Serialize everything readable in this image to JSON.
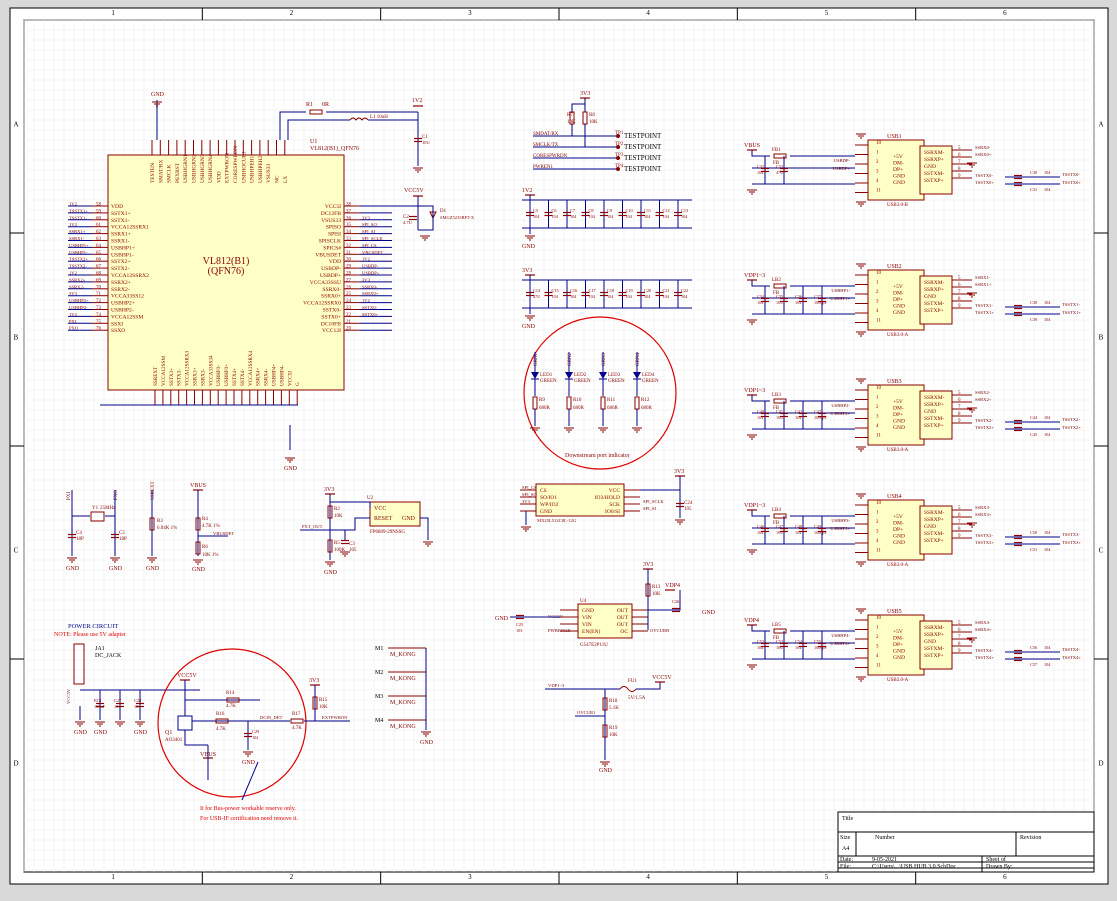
{
  "frame": {
    "col_labels": [
      "1",
      "2",
      "3",
      "4",
      "5",
      "6"
    ],
    "row_labels": [
      "A",
      "B",
      "C",
      "D"
    ]
  },
  "chip": {
    "label": "VL812(B1)",
    "sublabel": "(QFN76)",
    "designator": "U1",
    "comment": "VL812(B1)_QFN76",
    "left_pins": [
      "VDD",
      "SSTX1+",
      "SSTX1-",
      "VCCA12SSRX1",
      "SSRX1+",
      "SSRX1-",
      "USBHP1+",
      "USBHP1-",
      "SSTX2+",
      "SSTX2-",
      "VCCA12SSRX2",
      "SSRX2+",
      "SSRX2-",
      "VCCA33SS12",
      "USBHP2+",
      "USBHP2-",
      "VCCA12SSM",
      "SSXI",
      "SSXO"
    ],
    "left_nums": [
      "58",
      "59",
      "60",
      "61",
      "62",
      "63",
      "64",
      "65",
      "66",
      "67",
      "68",
      "69",
      "70",
      "71",
      "72",
      "73",
      "74",
      "75",
      "76"
    ],
    "right_pins": [
      "VCC5I",
      "DC12FB",
      "VSUS33",
      "SPISO",
      "SPISI",
      "SPISCLK",
      "SPICS#",
      "VBUSDET",
      "VDD",
      "USBDP-",
      "USBDP+",
      "VCCA33SSU",
      "SSRX0-",
      "SSRX0+",
      "VCCA12SSRX0",
      "SSTX0-",
      "SSTX0+",
      "DC10FB",
      "VCC12I"
    ],
    "right_nums": [
      "38",
      "37",
      "36",
      "35",
      "34",
      "33",
      "32",
      "31",
      "30",
      "29",
      "28",
      "27",
      "26",
      "25",
      "24",
      "23",
      "22",
      "21",
      "20"
    ],
    "top_pins": [
      "TESTEN",
      "SMAT/RX",
      "SMCLK",
      "PEXRST",
      "USBHGRN1",
      "USBHGRN2",
      "USBHGRN3",
      "USBHGRN4",
      "VDD",
      "EXTPWRON",
      "CORESPWRDN",
      "USBHOCUR1",
      "USBHPEH1",
      "USBHPEH2",
      "VSUS33",
      "NC",
      "LX"
    ],
    "bottom_pins": [
      "SSREXT",
      "VCCA12SSM",
      "SSTX3+",
      "SSTX3-",
      "VCCA12SSRX3",
      "SSRX3+",
      "SSRX3-",
      "VCCA33SS34",
      "USBHP3-",
      "USBHP3+",
      "SSTX4+",
      "SSTX4-",
      "VCCA12SSRX4",
      "SSRX4+",
      "SSRX4-",
      "USBHP4+",
      "USBHP4-",
      "VCC5I",
      "G"
    ],
    "left_nets": [
      "1V2",
      "TSSTX1+",
      "TSSTX1-",
      "1V2",
      "SSRX1+",
      "SSRX1-",
      "USBHP1+",
      "USBHP1-",
      "TSSTX2+",
      "TSSTX2-",
      "1V2",
      "SSRX2+",
      "SSRX2-",
      "3V3",
      "USBHP2+",
      "USBHP2-",
      "1V2",
      "PXI",
      "PXO"
    ],
    "right_nets": [
      "",
      "",
      "3V3",
      "SPI_SO",
      "SPI_SI",
      "SPI_SCLK",
      "SPI_CS",
      "VBUSDET",
      "1V2",
      "USBDP-",
      "USBDP+",
      "3V3",
      "SSRX0-",
      "SSRX0+",
      "1V2",
      "SSTX0-",
      "SSTX0+",
      "",
      ""
    ]
  },
  "power_top": {
    "gnd": "GND",
    "r1": "R1",
    "r1_val": "0R",
    "l1": "L1 10uH",
    "net_1v2": "1V2",
    "c1": "C1",
    "c1_val": "10U",
    "vcc5v": "VCC5V",
    "c2": "C2",
    "c2_val": "4.7U",
    "d1": "D1",
    "d1_val": "SMGZ5235BPT-X",
    "gnd_label": "GND"
  },
  "testpoints": {
    "net_3v3": "3V3",
    "r7": "R7",
    "r7_val": "10K",
    "r8": "R8",
    "r8_val": "10K",
    "nets": [
      "SMDAT/RX",
      "SMCLK/TX",
      "CORESPWRDN",
      "PWREN1"
    ],
    "tps": [
      "TP1",
      "TP2",
      "TP3",
      "TP4"
    ],
    "tp_label": "TESTPOINT"
  },
  "decoupling": {
    "net_1v2": "1V2",
    "net_3v3": "3V3",
    "gnd": "GND",
    "row1_caps": [
      "C5",
      "C6",
      "C7",
      "C8",
      "C9",
      "C10",
      "C11",
      "C12",
      "C13"
    ],
    "row1_val": "104",
    "row2_caps": [
      "C14",
      "C15",
      "C16",
      "C17",
      "C18",
      "C19",
      "C20",
      "C21",
      "C22"
    ],
    "row2_first_val": "47U",
    "row2_val": "104"
  },
  "leds": {
    "nets": [
      "GRN1",
      "GRN2",
      "GRN3",
      "GRN4"
    ],
    "leds": [
      "LED1",
      "LED2",
      "LED3",
      "LED4"
    ],
    "color": "GREEN",
    "resistors": [
      "R9",
      "R10",
      "R11",
      "R12"
    ],
    "res_val": "680R",
    "annotation": "Downstream port indicator"
  },
  "usb_ports": [
    {
      "designator": "USB1",
      "type": "USB3.0-B",
      "power": "VBUS",
      "fb": "FB1",
      "fb_val": "FB",
      "caps": [
        "C32",
        "C33"
      ],
      "cap_vals": [
        "104",
        "47U"
      ],
      "dm": "USBDP-",
      "dp": "USBDP+",
      "rx_minus": "SSRX0-",
      "rx_plus": "SSRX0+",
      "tx_minus": "TSSTX0-",
      "tx_plus": "TSSTX0+",
      "out_caps": [
        "C30",
        "C31"
      ]
    },
    {
      "designator": "USB2",
      "type": "USB3.0-A",
      "power": "VDP1~3",
      "fb": "LB2",
      "fb_val": "FB",
      "caps": [
        "C34",
        "C35",
        "C36",
        "C37"
      ],
      "cap_vals": [
        "104",
        "10U",
        "104",
        "1000pF"
      ],
      "dm": "USBHP1-",
      "dp": "USBHP1+",
      "rx_minus": "SSRX1-",
      "rx_plus": "SSRX1+",
      "tx_minus": "TSSTX1-",
      "tx_plus": "TSSTX1+",
      "out_caps": [
        "C38",
        "C39"
      ]
    },
    {
      "designator": "USB3",
      "type": "USB3.0-A",
      "power": "VDP1~3",
      "fb": "LB3",
      "fb_val": "FB",
      "caps": [
        "C40",
        "C41",
        "C42",
        "C43"
      ],
      "cap_vals": [
        "104",
        "10U",
        "104",
        "1000pF"
      ],
      "dm": "USBHP2-",
      "dp": "USBHP2+",
      "rx_minus": "SSRX2-",
      "rx_plus": "SSRX2+",
      "tx_minus": "TSSTX2-",
      "tx_plus": "TSSTX2+",
      "out_caps": [
        "C44",
        "C45"
      ]
    },
    {
      "designator": "USB4",
      "type": "USB3.0-A",
      "power": "VDP1~3",
      "fb": "LB4",
      "fb_val": "FB",
      "caps": [
        "C46",
        "C47",
        "C48",
        "C49"
      ],
      "cap_vals": [
        "104",
        "10U",
        "104",
        "1000pF"
      ],
      "dm": "USBHP3-",
      "dp": "USBHP3+",
      "rx_minus": "SSRX3-",
      "rx_plus": "SSRX3+",
      "tx_minus": "TSSTX3-",
      "tx_plus": "TSSTX3+",
      "out_caps": [
        "C50",
        "C51"
      ]
    },
    {
      "designator": "USB5",
      "type": "USB3.0-A",
      "power": "VDP4",
      "fb": "LB5",
      "fb_val": "FB",
      "caps": [
        "C52",
        "C53",
        "C54",
        "C55"
      ],
      "cap_vals": [
        "104",
        "10U",
        "104",
        "1000pF"
      ],
      "dm": "USBHP4-",
      "dp": "USBHP4+",
      "rx_minus": "SSRX4-",
      "rx_plus": "SSRX4+",
      "tx_minus": "TSSTX4-",
      "tx_plus": "TSSTX4+",
      "out_caps": [
        "C56",
        "C57"
      ]
    }
  ],
  "usb_pins": {
    "n10": "10",
    "n5": "5",
    "n6": "6",
    "n7": "7",
    "n8": "8",
    "n9": "9",
    "n11": "11",
    "n1": "1",
    "n2": "2",
    "n3": "3",
    "n4": "4",
    "left": [
      "+5V",
      "DM-",
      "DP+",
      "GND",
      "GND"
    ],
    "right": [
      "SSRXM-",
      "SSRXP+",
      "GND",
      "SSTXM-",
      "SSTXP+"
    ],
    "cap_val": "104"
  },
  "crystal": {
    "y1": "Y1",
    "y1_val": "25MHz",
    "c4": "C4",
    "c4_val": "18P",
    "c5": "C5",
    "c5_val": "18P",
    "net_xi": "PXI",
    "net_xo": "PXO",
    "gnd": "GND"
  },
  "ssrext": {
    "r3": "R3",
    "r3_val": "6.04K 1%",
    "net": "SSREXT",
    "gnd": "GND"
  },
  "vbusdet": {
    "vbus": "VBUS",
    "r4": "R4",
    "r4_val": "4.7K 1%",
    "net": "VBUSDET",
    "r6": "R6",
    "r6_val": "10K 1%",
    "gnd": "GND"
  },
  "reset": {
    "net_3v3": "3V3",
    "r2": "R2",
    "r2_val": "10K",
    "r5": "R5",
    "r5_val": "100K",
    "c3": "C3",
    "c3_val": "105",
    "u2": "U2",
    "u2_val": "FP6809-29NSSG",
    "pin_vcc": "VCC",
    "pin_reset": "RESET",
    "pin_gnd": "GND",
    "net": "PXT_OUT",
    "gnd": "GND"
  },
  "flash": {
    "u3_val": "MX25L512C0L-12G",
    "pins_left": [
      "CS",
      "SO/IO1",
      "WP/IO2",
      "GND"
    ],
    "pins_right": [
      "VCC",
      "IO3/HOLD",
      "SCK",
      "IO0/SI"
    ],
    "nets_left": [
      "SPI_CS",
      "SPI_SO",
      "3V3"
    ],
    "nets_right": [
      "SPI_SCLK",
      "SPI_SI"
    ],
    "net_3v3": "3V3",
    "c24": "C24",
    "c24_val": "105",
    "gnd": "GND"
  },
  "switch_u4": {
    "u4": "U4",
    "u4_val": "G547E2P11U",
    "pins_left": [
      "GND",
      "VIN",
      "VIN",
      "EN(EN)"
    ],
    "pins_right": [
      "OUT",
      "OUT",
      "OUT",
      "OC"
    ],
    "net_vcc": "VCC5V",
    "net_en": "PWRENGR",
    "net_oc": "OVCURB",
    "net_3v3": "3V3",
    "r13": "R13",
    "r13_val": "10K",
    "vdp4": "VDP4",
    "c25": "C25",
    "c25_val": "103",
    "c26": "C26",
    "c26_val": "104",
    "gnd": "GND"
  },
  "fuse": {
    "net_in": "VDP1~3",
    "fu1": "FU1",
    "fu1_val": "5V/1.5A",
    "net_out": "VCC5V",
    "r18": "R18",
    "r18_val": "5.1K",
    "r19": "R19",
    "r19_val": "10K",
    "net_oc": "OVCUR1",
    "gnd": "GND",
    "net_3v3": "3V3"
  },
  "mounting": {
    "items": [
      "M1",
      "M2",
      "M3",
      "M4"
    ],
    "val": "M_KONG",
    "gnd": "GND"
  },
  "power_circuit": {
    "title": "POWER CIRCUIT",
    "note": "NOTE: Please use 5V adapter",
    "ja1": "JA1",
    "ja1_val": "DC_JACK",
    "ec1": "EC1",
    "ec1_val": "100uF",
    "c27": "C27",
    "c27_val": "104",
    "c28": "C28",
    "c28_val": "104",
    "net_vcc5v": "VCC5V",
    "r14": "R14",
    "r14_val": "4.7K",
    "r16": "R16",
    "r16_val": "4.7K",
    "q1": "Q1",
    "q1_val": "AO3401",
    "vbus": "VBUS",
    "c29": "C29",
    "c29_val": "104",
    "net_dcin": "DCIN_DET",
    "r17": "R17",
    "r17_val": "4.7K",
    "net_3v3": "3V3",
    "r15": "R15",
    "r15_val": "10K",
    "net_ext": "EXTPWRON",
    "gnd": "GND"
  },
  "bus_note": {
    "line1": "It for Bus-power workable reserve only.",
    "line2": "For USB-IF certification need remove it."
  },
  "title_block": {
    "title": "Title",
    "size": "Size",
    "size_val": "A4",
    "number": "Number",
    "revision": "Revision",
    "date": "Date:",
    "date_val": "9-05-2021",
    "sheet": "Sheet   of",
    "file": "File:",
    "file_val": "C:\\Users\\...\\USB HUB 3.0.SchDoc",
    "drawn": "Drawn By:"
  },
  "colors": {
    "wire": "#00008b",
    "part": "#8b0000",
    "net": "#7a0000",
    "body": "#ffffc8",
    "ring": "#e00000",
    "paper": "#ffffff",
    "frame": "#000000"
  }
}
